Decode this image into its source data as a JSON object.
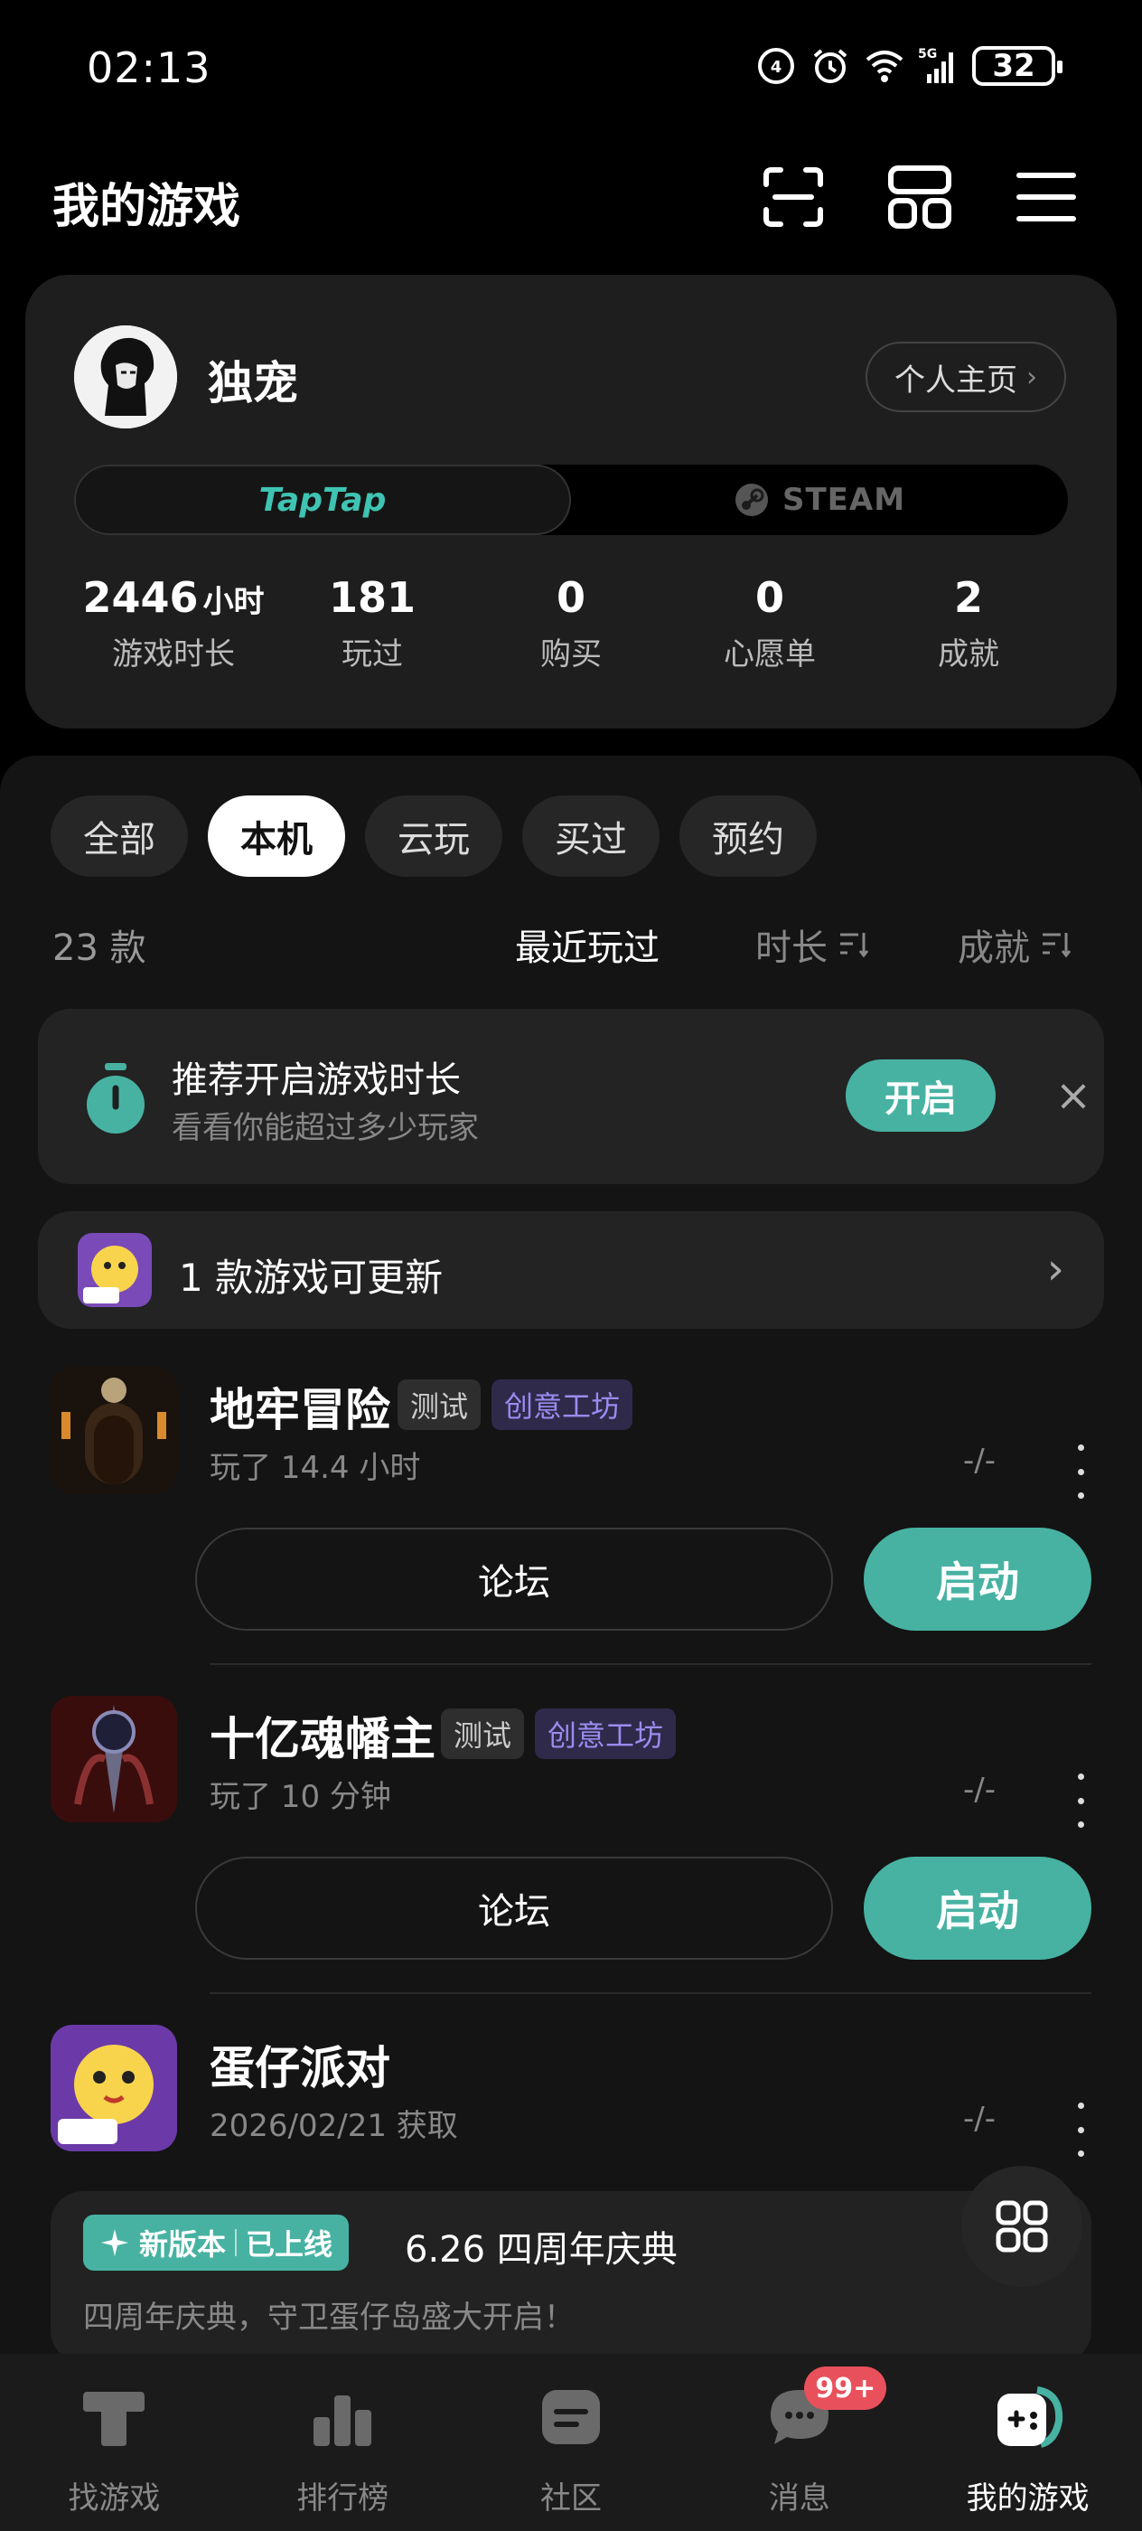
{
  "status_bar": {
    "time": "02:13",
    "battery": "32"
  },
  "header": {
    "title": "我的游戏"
  },
  "profile": {
    "username": "独宠",
    "homepage_label": "个人主页",
    "platforms": [
      "TapTap",
      "STEAM"
    ],
    "stats": [
      {
        "value": "2446",
        "unit": "小时",
        "label": "游戏时长"
      },
      {
        "value": "181",
        "unit": "",
        "label": "玩过"
      },
      {
        "value": "0",
        "unit": "",
        "label": "购买"
      },
      {
        "value": "0",
        "unit": "",
        "label": "心愿单"
      },
      {
        "value": "2",
        "unit": "",
        "label": "成就"
      }
    ]
  },
  "filters": [
    "全部",
    "本机",
    "云玩",
    "买过",
    "预约"
  ],
  "active_filter": "本机",
  "library": {
    "count": "23 款",
    "sort": [
      "最近玩过",
      "时长",
      "成就"
    ]
  },
  "recommendation": {
    "title": "推荐开启游戏时长",
    "subtitle": "看看你能超过多少玩家",
    "button": "开启"
  },
  "update_bar": {
    "text": "1 款游戏可更新"
  },
  "games": [
    {
      "name": "地牢冒险",
      "tags": [
        "测试",
        "创意工坊"
      ],
      "meta": "玩了 14.4 小时",
      "score": "-/-",
      "forum": "论坛",
      "launch": "启动"
    },
    {
      "name": "十亿魂幡主",
      "tags": [
        "测试",
        "创意工坊"
      ],
      "meta": "玩了 10 分钟",
      "score": "-/-",
      "forum": "论坛",
      "launch": "启动"
    },
    {
      "name": "蛋仔派对",
      "tags": [],
      "meta": "2026/02/21 获取",
      "score": "-/-"
    }
  ],
  "promo": {
    "badge_left": "新版本",
    "badge_right": "已上线",
    "title": "6.26 四周年庆典",
    "subtitle": "四周年庆典，守卫蛋仔岛盛大开启！"
  },
  "bottom_nav": {
    "items": [
      "找游戏",
      "排行榜",
      "社区",
      "消息",
      "我的游戏"
    ],
    "badge": "99+"
  },
  "colors": {
    "accent": "#47b2a2",
    "workshop": "#9a8cf0",
    "badge": "#e8505b"
  }
}
